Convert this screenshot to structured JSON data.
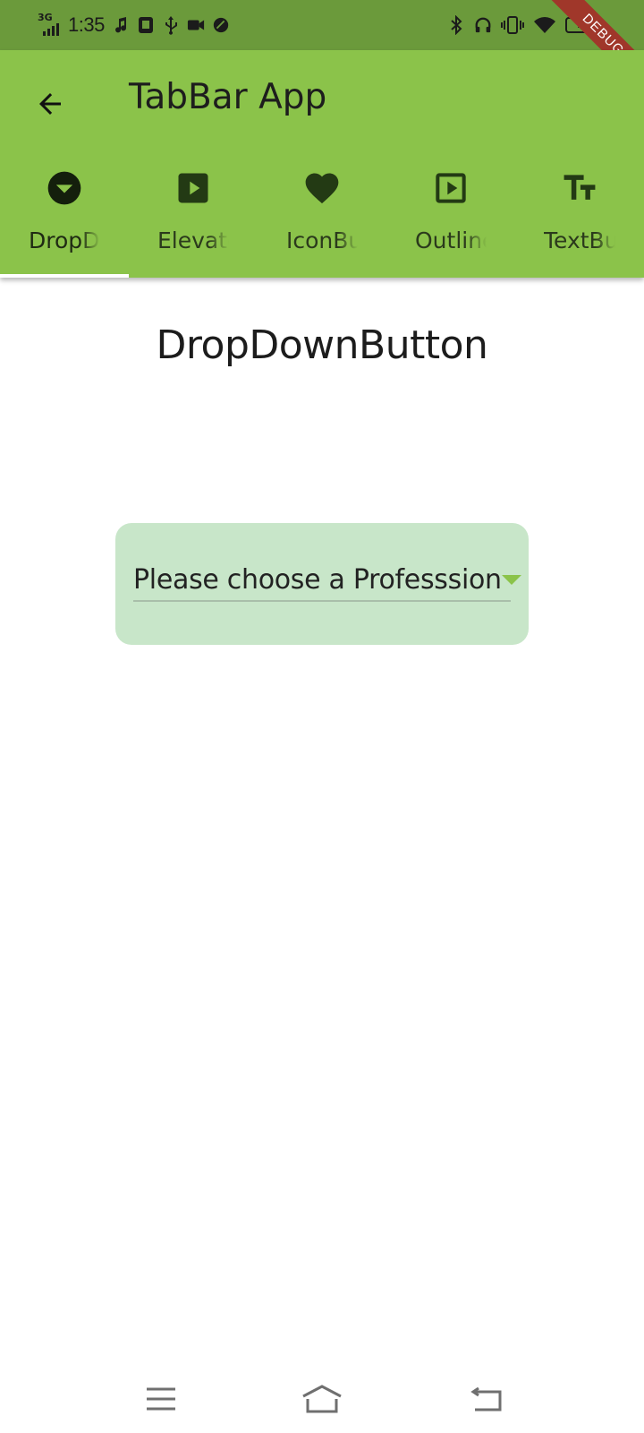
{
  "status_bar": {
    "network": "3G",
    "time": "1:35",
    "battery": "71",
    "debug_banner": "DEBUG"
  },
  "app_bar": {
    "title": "TabBar App",
    "back_icon": "arrow-back-icon"
  },
  "tabs": [
    {
      "label": "DropDownButton",
      "icon": "arrow-drop-down-circle-icon",
      "selected": true
    },
    {
      "label": "ElevatedButton",
      "icon": "slideshow-icon",
      "selected": false
    },
    {
      "label": "IconButton",
      "icon": "favorite-icon",
      "selected": false
    },
    {
      "label": "OutlinedButton",
      "icon": "slideshow-outlined-icon",
      "selected": false
    },
    {
      "label": "TextButton",
      "icon": "text-fields-icon",
      "selected": false
    }
  ],
  "content": {
    "title": "DropDownButton",
    "dropdown": {
      "hint": "Please choose a Professsion",
      "icon": "arrow-drop-down-icon"
    }
  },
  "colors": {
    "status_bar": "#6b9a3b",
    "app_bar": "#8bc34a",
    "dropdown_card": "#c8e6c9",
    "indicator": "#ffffff",
    "debug_ribbon": "#a0372a"
  },
  "nav_bar": {
    "items": [
      "menu-icon",
      "home-icon",
      "back-icon"
    ]
  }
}
